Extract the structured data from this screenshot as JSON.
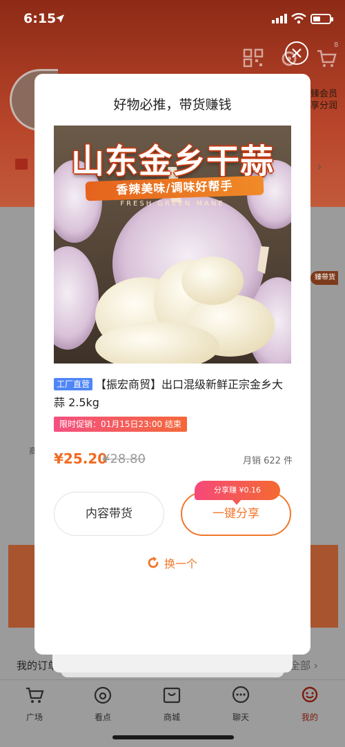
{
  "status_bar": {
    "time": "6:15"
  },
  "background": {
    "member_text": "臻会员",
    "member_sub": "享分润",
    "promo_tag": "臻带货",
    "cell_left": "商",
    "orders_label": "我的订单",
    "all_label": "全部",
    "cart_badge": "8"
  },
  "modal": {
    "title": "好物必推，带货赚钱",
    "image": {
      "headline": "山东金乡干蒜",
      "ribbon": "香辣美味/调味好帮手",
      "sub": "FRESH GREEN MANE"
    },
    "product": {
      "tag": "工厂直营",
      "title": "【振宏商贸】出口混级新鲜正宗金乡大蒜 2.5kg",
      "promo": "限时促销：01月15日23:00 结束",
      "price": "¥25.20",
      "original_price": "¥28.80",
      "sales": "月销 622 件"
    },
    "buttons": {
      "content": "内容带货",
      "share": "一键分享",
      "earn_badge": "分享赚 ¥0.16",
      "refresh": "换一个"
    }
  },
  "tabbar": {
    "items": [
      {
        "label": "广场",
        "icon": "cart-icon"
      },
      {
        "label": "看点",
        "icon": "eye-icon"
      },
      {
        "label": "商城",
        "icon": "shop-icon"
      },
      {
        "label": "聊天",
        "icon": "chat-icon"
      },
      {
        "label": "我的",
        "icon": "profile-icon",
        "active": true
      }
    ]
  },
  "colors": {
    "accent": "#f0772a",
    "price": "#f26a20",
    "tag_blue": "#4f86f7",
    "promo_gradient_start": "#f45080",
    "promo_gradient_end": "#f4683a"
  }
}
